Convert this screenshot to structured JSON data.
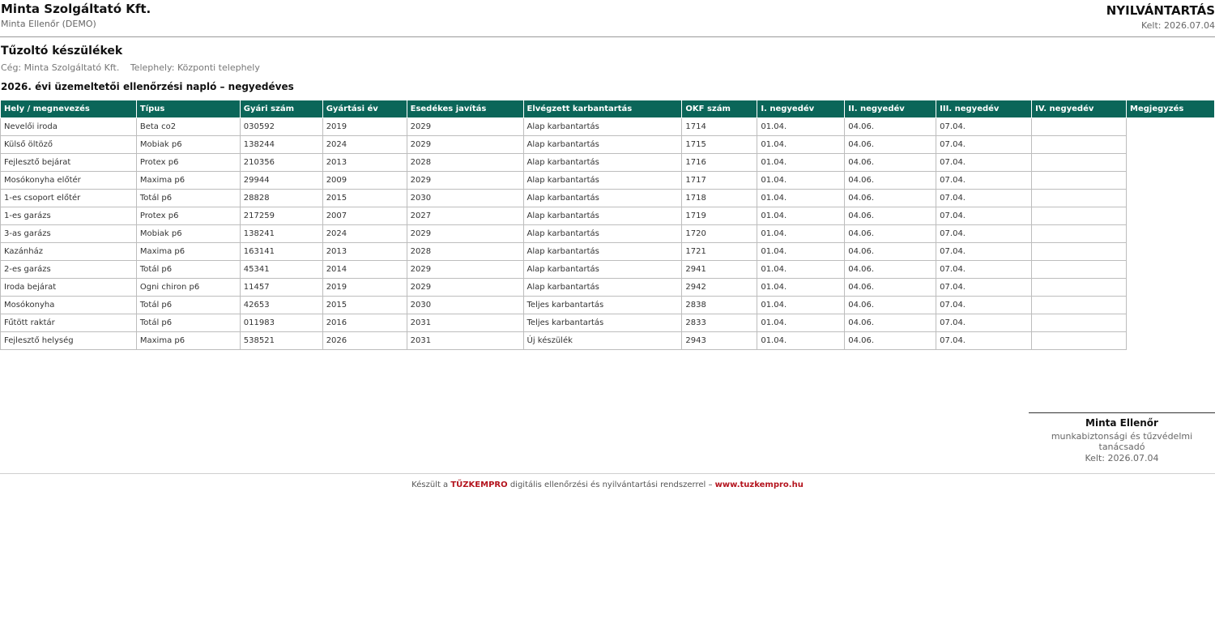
{
  "header": {
    "company": "Minta Szolgáltató Kft.",
    "inspector": "Minta Ellenőr (DEMO)",
    "doc_title": "NYILVÁNTARTÁS",
    "doc_date": "Kelt: 2026.07.04"
  },
  "section": {
    "title": "Tűzoltó készülékek",
    "company_label": "Cég: Minta Szolgáltató Kft.",
    "site_label": "Telephely: Központi telephely",
    "log_title": "2026. évi üzemeltetői ellenőrzési napló – negyedéves"
  },
  "table": {
    "columns": [
      "Hely / megnevezés",
      "Típus",
      "Gyári szám",
      "Gyártási év",
      "Esedékes javítás",
      "Elvégzett karbantartás",
      "OKF szám",
      "I. negyedév",
      "II. negyedév",
      "III. negyedév",
      "IV. negyedév",
      "Megjegyzés"
    ],
    "rows": [
      [
        "Nevelői iroda",
        "Beta co2",
        "030592",
        "2019",
        "2029",
        "Alap karbantartás",
        "1714",
        "01.04.",
        "04.06.",
        "07.04.",
        ""
      ],
      [
        "Külső öltöző",
        "Mobiak p6",
        "138244",
        "2024",
        "2029",
        "Alap karbantartás",
        "1715",
        "01.04.",
        "04.06.",
        "07.04.",
        ""
      ],
      [
        "Fejlesztő bejárat",
        "Protex p6",
        "210356",
        "2013",
        "2028",
        "Alap karbantartás",
        "1716",
        "01.04.",
        "04.06.",
        "07.04.",
        ""
      ],
      [
        "Mosókonyha előtér",
        "Maxima p6",
        "29944",
        "2009",
        "2029",
        "Alap karbantartás",
        "1717",
        "01.04.",
        "04.06.",
        "07.04.",
        ""
      ],
      [
        "1-es csoport előtér",
        "Totál p6",
        "28828",
        "2015",
        "2030",
        "Alap karbantartás",
        "1718",
        "01.04.",
        "04.06.",
        "07.04.",
        ""
      ],
      [
        "1-es garázs",
        "Protex p6",
        "217259",
        "2007",
        "2027",
        "Alap karbantartás",
        "1719",
        "01.04.",
        "04.06.",
        "07.04.",
        ""
      ],
      [
        "3-as garázs",
        "Mobiak p6",
        "138241",
        "2024",
        "2029",
        "Alap karbantartás",
        "1720",
        "01.04.",
        "04.06.",
        "07.04.",
        ""
      ],
      [
        "Kazánház",
        "Maxima p6",
        "163141",
        "2013",
        "2028",
        "Alap karbantartás",
        "1721",
        "01.04.",
        "04.06.",
        "07.04.",
        ""
      ],
      [
        "2-es garázs",
        "Totál p6",
        "45341",
        "2014",
        "2029",
        "Alap karbantartás",
        "2941",
        "01.04.",
        "04.06.",
        "07.04.",
        ""
      ],
      [
        "Iroda bejárat",
        "Ogni chiron p6",
        "11457",
        "2019",
        "2029",
        "Alap karbantartás",
        "2942",
        "01.04.",
        "04.06.",
        "07.04.",
        ""
      ],
      [
        "Mosókonyha",
        "Totál p6",
        "42653",
        "2015",
        "2030",
        "Teljes karbantartás",
        "2838",
        "01.04.",
        "04.06.",
        "07.04.",
        ""
      ],
      [
        "Fűtött raktár",
        "Totál p6",
        "011983",
        "2016",
        "2031",
        "Teljes karbantartás",
        "2833",
        "01.04.",
        "04.06.",
        "07.04.",
        ""
      ],
      [
        "Fejlesztő helység",
        "Maxima p6",
        "538521",
        "2026",
        "2031",
        "Új készülék",
        "2943",
        "01.04.",
        "04.06.",
        "07.04.",
        ""
      ]
    ]
  },
  "signature": {
    "name": "Minta Ellenőr",
    "role": "munkabiztonsági és tűzvédelmi tanácsadó",
    "date": "Kelt: 2026.07.04"
  },
  "footer": {
    "prefix": "Készült a",
    "brand": "TŰZKEMPRO",
    "middle": "digitális ellenőrzési és nyilvántartási rendszerrel –",
    "site": "www.tuzkempro.hu"
  },
  "colors": {
    "header_bg": "#0b6659",
    "brand_red": "#b4141e"
  }
}
